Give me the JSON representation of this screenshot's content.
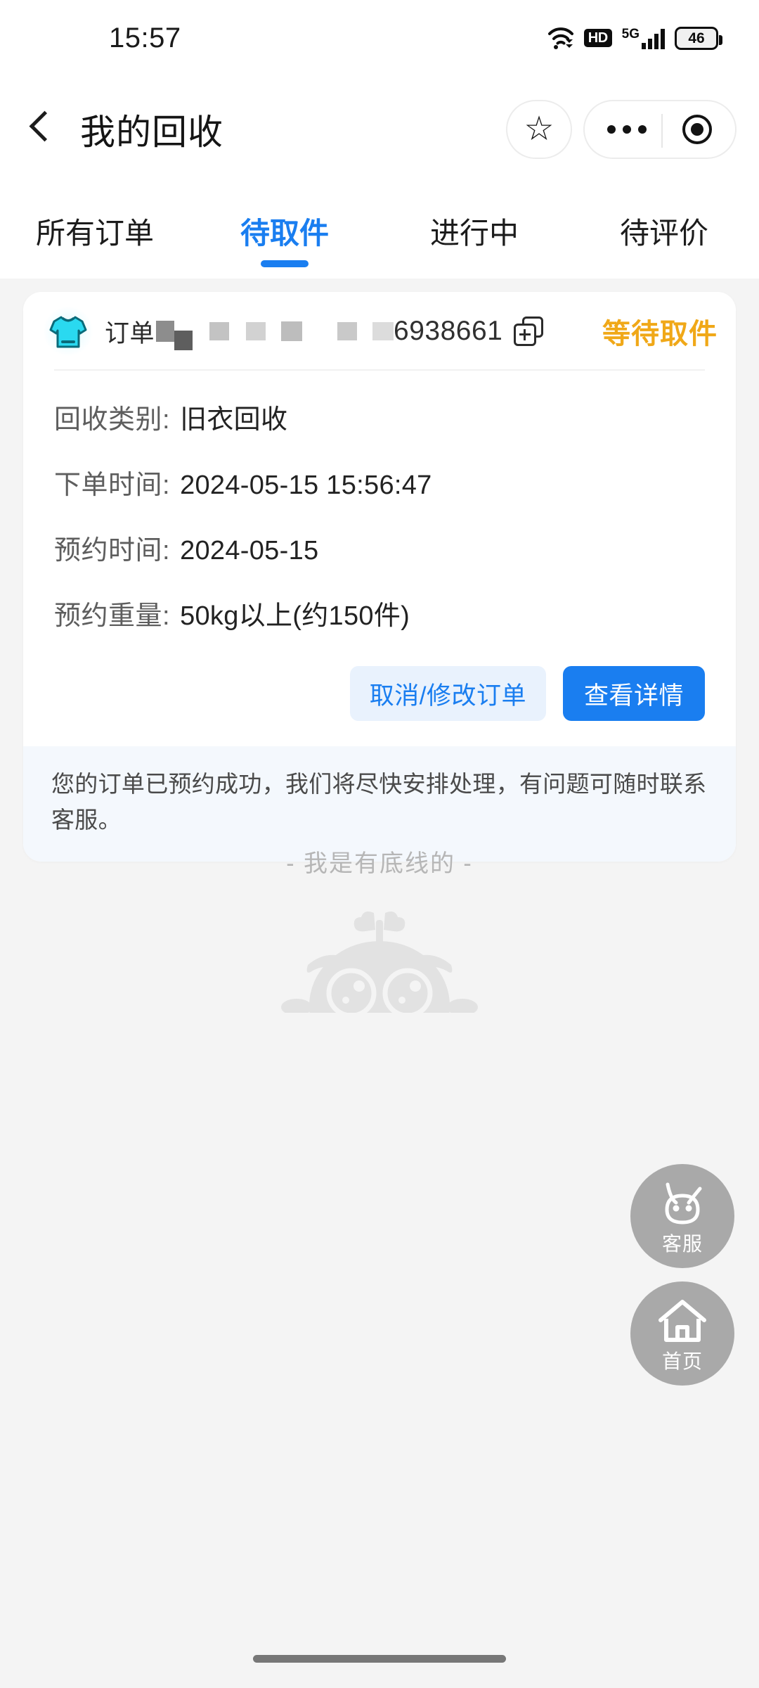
{
  "status_bar": {
    "time": "15:57",
    "battery_percent": "46",
    "network_hd": "HD",
    "network_gen": "5G",
    "icons": [
      "wifi-icon",
      "hd-icon",
      "5g-signal-icon",
      "battery-icon"
    ]
  },
  "nav": {
    "back_icon": "chevron-left-icon",
    "title": "我的回收",
    "star_icon": "★",
    "more_icon": "more-dots-icon",
    "target_icon": "target-icon"
  },
  "tabs": [
    {
      "label": "所有订单",
      "active": false
    },
    {
      "label": "待取件",
      "active": true
    },
    {
      "label": "进行中",
      "active": false
    },
    {
      "label": "待评价",
      "active": false
    }
  ],
  "order": {
    "category_icon": "tshirt-icon",
    "order_label": "订单",
    "order_number_tail": "6938661",
    "order_number_redacted": true,
    "copy_icon": "copy-icon",
    "status": "等待取件",
    "status_color": "#f0a818",
    "details": [
      {
        "label": "回收类别:",
        "value": "旧衣回收"
      },
      {
        "label": "下单时间:",
        "value": "2024-05-15 15:56:47"
      },
      {
        "label": "预约时间:",
        "value": "2024-05-15"
      },
      {
        "label": "预约重量:",
        "value": "50kg以上(约150件)"
      }
    ],
    "actions": [
      {
        "label": "取消/修改订单",
        "style": "secondary"
      },
      {
        "label": "查看详情",
        "style": "primary"
      }
    ],
    "note": "您的订单已预约成功，我们将尽快安排处理，有问题可随时联系客服。"
  },
  "list_end": {
    "text": "- 我是有底线的 -",
    "mascot_icon": "mascot-watermark-icon"
  },
  "floating_buttons": [
    {
      "label": "客服",
      "icon": "robot-face-icon"
    },
    {
      "label": "首页",
      "icon": "home-icon"
    }
  ],
  "colors": {
    "accent_blue": "#1a7ef0",
    "status_orange": "#f0a818",
    "page_bg": "#f4f4f4",
    "card_bg": "#ffffff",
    "note_bg": "#f4f8fd",
    "shirt_cyan": "#28d6ef"
  }
}
